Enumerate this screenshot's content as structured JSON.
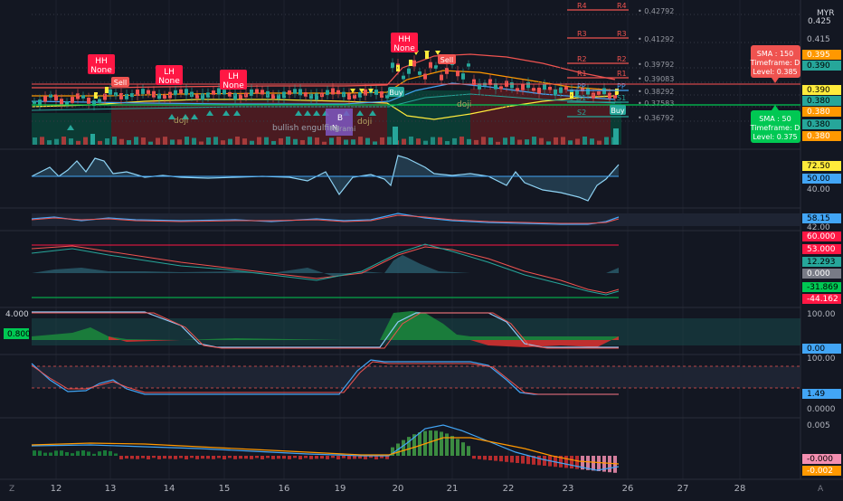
{
  "currency": "MYR",
  "colors": {
    "bg": "#131722",
    "grid": "#1e222d",
    "text": "#b2b5be",
    "up": "#26a69a",
    "down": "#ef5350",
    "orange": "#ff9800",
    "yellow": "#ffeb3b",
    "blue": "#42a5f5",
    "green": "#00c853",
    "red": "#ff1744",
    "purple": "#7e57c2"
  },
  "price_axis": {
    "top_label": "0.425",
    "labels": [
      {
        "t": "0.415",
        "color": "none"
      },
      {
        "t": "0.395",
        "color": "#ff9800"
      },
      {
        "t": "0.390",
        "color": "#26a69a"
      },
      {
        "t": "0.390",
        "color": "#ffeb3b"
      },
      {
        "t": "0.380",
        "color": "#26a69a"
      },
      {
        "t": "0.380",
        "color": "#ff9800"
      },
      {
        "t": "0.380",
        "color": "#26a69a"
      },
      {
        "t": "0.380",
        "color": "#ff9800"
      }
    ]
  },
  "pivots": [
    {
      "left": "R4",
      "right": "R4",
      "value": "0.42792",
      "color": "#ef5350"
    },
    {
      "left": "R3",
      "right": "R3",
      "value": "0.41292",
      "color": "#ef5350"
    },
    {
      "left": "R2",
      "right": "R2",
      "value": "0.39792",
      "color": "#ef5350"
    },
    {
      "left": "R1",
      "right": "R1",
      "value": "0.39083",
      "color": "#ef5350"
    },
    {
      "left": "PP",
      "right": "PP",
      "value": "0.38292",
      "color": "#42a5f5"
    },
    {
      "left": "S1",
      "right": "S1",
      "value": "0.37583",
      "color": "#26a69a"
    },
    {
      "left": "S2",
      "right": "S2",
      "value": "0.36792",
      "color": "#26a69a"
    }
  ],
  "sma_tooltips": {
    "sma150": {
      "line1": "SMA : 150",
      "line2": "Timeframe: D",
      "line3": "Level: 0.385"
    },
    "sma50": {
      "line1": "SMA : 50",
      "line2": "Timeframe: D",
      "line3": "Level: 0.375"
    }
  },
  "signals": [
    {
      "l1": "HH",
      "l2": "None"
    },
    {
      "l1": "LH",
      "l2": "None"
    },
    {
      "l1": "LH",
      "l2": "None"
    },
    {
      "l1": "HH",
      "l2": "None"
    }
  ],
  "trade_labels": {
    "sell": "Sell",
    "buy": "Buy",
    "b": "B",
    "n": "N"
  },
  "pattern_labels": {
    "doji": "doji",
    "bullish": "bullish engulfing",
    "harami": "harami",
    "engulfing": "engulfing"
  },
  "panes": {
    "rsi": {
      "labels": [
        {
          "t": "72.50",
          "color": "#ffeb3b"
        },
        {
          "t": "50.00",
          "color": "#42a5f5"
        },
        {
          "t": "40.00",
          "color": "none"
        }
      ]
    },
    "stoch": {
      "labels": [
        {
          "t": "58.15",
          "color": "#42a5f5"
        },
        {
          "t": "42.00",
          "color": "none"
        }
      ]
    },
    "macd": {
      "labels": [
        {
          "t": "60.000",
          "color": "#ff1744"
        },
        {
          "t": "53.000",
          "color": "#ff1744"
        },
        {
          "t": "12.293",
          "color": "#26a69a"
        },
        {
          "t": "0.000",
          "color": "#787b86"
        },
        {
          "t": "-31.869",
          "color": "#00c853"
        },
        {
          "t": "-44.162",
          "color": "#ff1744"
        }
      ]
    },
    "osc": {
      "left_top": "4.000",
      "left_val": "0.800",
      "labels": [
        {
          "t": "100.00",
          "color": "none"
        },
        {
          "t": "0.00",
          "color": "#42a5f5"
        }
      ]
    },
    "stoch2": {
      "labels": [
        {
          "t": "100.00",
          "color": "none"
        },
        {
          "t": "1.49",
          "color": "#42a5f5"
        },
        {
          "t": "0.0000",
          "color": "none"
        }
      ]
    },
    "hist": {
      "labels": [
        {
          "t": "0.005",
          "color": "none"
        },
        {
          "t": "-0.000",
          "color": "#f48fb1"
        },
        {
          "t": "-0.002",
          "color": "#ff9800"
        }
      ]
    }
  },
  "time_axis": [
    "12",
    "13",
    "14",
    "15",
    "16",
    "19",
    "20",
    "21",
    "22",
    "23",
    "26",
    "27",
    "28"
  ],
  "footer": {
    "left_icon_label": "Z",
    "right_icon_label": "A"
  }
}
